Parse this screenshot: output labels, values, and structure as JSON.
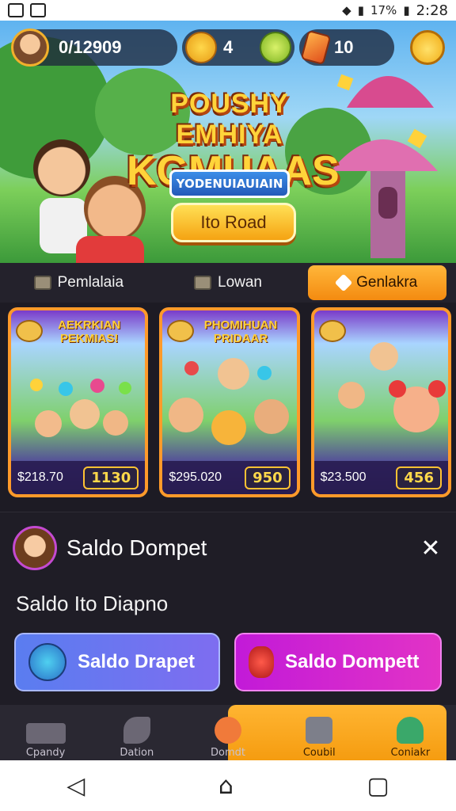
{
  "status_bar": {
    "battery": "17%",
    "time": "2:28"
  },
  "header": {
    "balance": "0/12909",
    "coins": "4",
    "gems": "10"
  },
  "hero": {
    "title_line1": "POUSHY EMHIYA",
    "title_line2": "KGMUAAS",
    "subtitle": "YODENUIAUIAIN",
    "button_label": "Ito Road"
  },
  "tabs": [
    {
      "label": "Pemlalaia"
    },
    {
      "label": "Lowan"
    },
    {
      "label": "Genlakra"
    }
  ],
  "cards": [
    {
      "title": "AEKRKIAN PEKMIAS!",
      "price": "$218.70",
      "badge": "1130"
    },
    {
      "title": "PHOMIHUAN PRIDAAR",
      "price": "$295.020",
      "badge": "950"
    },
    {
      "title": "",
      "price": "$23.500",
      "badge": "456"
    }
  ],
  "panel": {
    "title": "Saldo Dompet",
    "label": "Saldo Ito Diapno",
    "button_a": "Saldo Drapet",
    "button_b": "Saldo Dompett"
  },
  "bottom_nav": [
    {
      "label": "Cpandy",
      "icon": "chart-icon"
    },
    {
      "label": "Dation",
      "icon": "leaf-icon"
    },
    {
      "label": "Domdt",
      "icon": "face-icon"
    },
    {
      "label": "Coubil",
      "icon": "robot-icon"
    },
    {
      "label": "Coniakr",
      "icon": "heart-icon"
    }
  ],
  "colors": {
    "accent_orange": "#f59c10",
    "panel_bg": "#1f1d26",
    "button_blue": "#6b76f0",
    "button_magenta": "#d126cf"
  }
}
